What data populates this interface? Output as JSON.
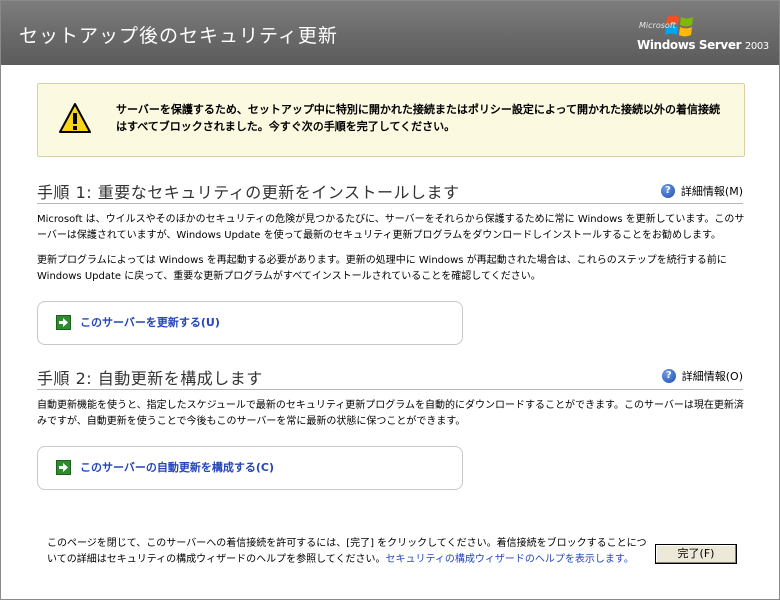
{
  "window": {
    "title": "セットアップ後のセキュリティ更新",
    "brand_small": "Microsoft",
    "brand_main": "Windows Server",
    "brand_year": "2003"
  },
  "warning": {
    "text": "サーバーを保護するため、セットアップ中に特別に開かれた接続またはポリシー設定によって開かれた接続以外の着信接続はすべてブロックされました。今すぐ次の手順を完了してください。"
  },
  "step1": {
    "title": "手順 1: 重要なセキュリティの更新をインストールします",
    "more_info": "詳細情報(M)",
    "para1": "Microsoft は、ウイルスやそのほかのセキュリティの危険が見つかるたびに、サーバーをそれらから保護するために常に Windows を更新しています。このサーバーは保護されていますが、Windows Update を使って最新のセキュリティ更新プログラムをダウンロードしインストールすることをお勧めします。",
    "para2": "更新プログラムによっては Windows を再起動する必要があります。更新の処理中に Windows が再起動された場合は、これらのステップを続行する前に Windows Update に戻って、重要な更新プログラムがすべてインストールされていることを確認してください。",
    "action": "このサーバーを更新する(U)"
  },
  "step2": {
    "title": "手順 2: 自動更新を構成します",
    "more_info": "詳細情報(O)",
    "para": "自動更新機能を使うと、指定したスケジュールで最新のセキュリティ更新プログラムを自動的にダウンロードすることができます。このサーバーは現在更新済みですが、自動更新を使うことで今後もこのサーバーを常に最新の状態に保つことができます。",
    "action": "このサーバーの自動更新を構成する(C)"
  },
  "footer": {
    "text": "このページを閉じて、このサーバーへの着信接続を許可するには、[完了] をクリックしてください。着信接続をブロックすることについての詳細はセキュリティの構成ウィザードのヘルプを参照してください。",
    "link": "セキュリティの構成ウィザードのヘルプを表示します。",
    "finish_button": "完了(F)"
  },
  "colors": {
    "link": "#2446b8",
    "title_bar": "#6e6e6e",
    "warning_bg": "#fbf9e0"
  },
  "icons": {
    "warning": "warning-triangle-icon",
    "help": "help-icon",
    "action": "green-arrow-icon",
    "logo": "windows-flag-icon"
  }
}
